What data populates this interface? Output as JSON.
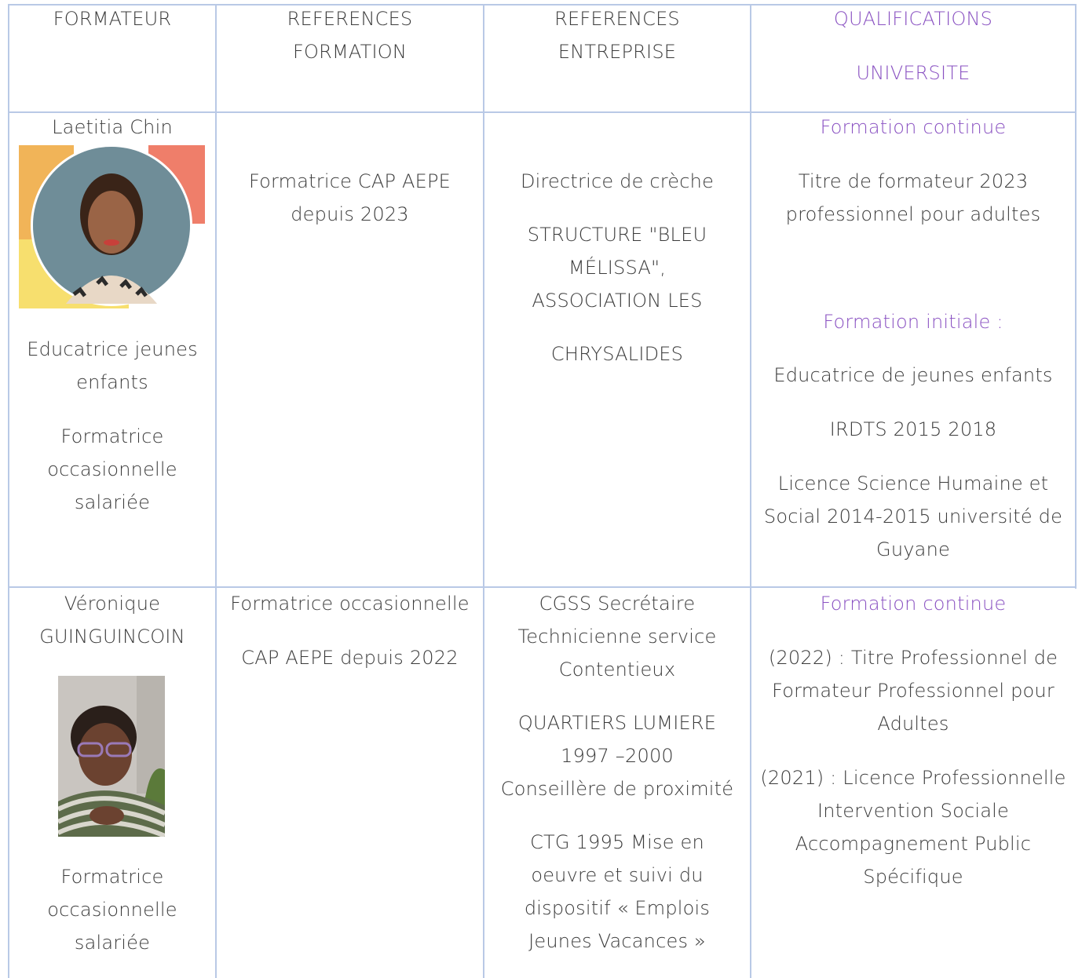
{
  "header": {
    "formateur": "FORMATEUR",
    "ref_formation": [
      "REFERENCES",
      "FORMATION"
    ],
    "ref_entreprise": [
      "REFERENCES",
      "ENTREPRISE"
    ],
    "qualifications": "QUALIFICATIONS",
    "universite": "UNIVERSITE"
  },
  "row1": {
    "name": "Laetitia Chin",
    "role1": [
      "Educatrice jeunes",
      "enfants"
    ],
    "role2": [
      "Formatrice",
      "occasionnelle",
      "salariée"
    ],
    "formation": [
      "Formatrice CAP AEPE",
      "depuis 2023"
    ],
    "entreprise": {
      "p1": "Directrice de crèche",
      "p2": [
        "STRUCTURE \"BLEU",
        "MÉLISSA\",",
        "ASSOCIATION LES"
      ],
      "p3": "CHRYSALIDES"
    },
    "qualif": {
      "continue_title": "Formation continue",
      "continue_text": [
        "Titre de formateur 2023",
        "professionnel pour adultes"
      ],
      "initiale_title": "Formation initiale :",
      "p1": "Educatrice de jeunes enfants",
      "p2": "IRDTS 2015 2018",
      "p3": [
        "Licence Science Humaine et",
        "Social 2014-2015 université de",
        "Guyane"
      ]
    }
  },
  "row2": {
    "name": [
      "Véronique",
      "GUINGUINCOIN"
    ],
    "role": [
      "Formatrice",
      "occasionnelle",
      "salariée"
    ],
    "formation": {
      "p1": "Formatrice occasionnelle",
      "p2": "CAP AEPE depuis 2022"
    },
    "entreprise": {
      "p1": [
        "CGSS Secrétaire",
        "Technicienne service",
        "Contentieux"
      ],
      "p2": [
        "QUARTIERS LUMIERE",
        "1997 –2000",
        "Conseillère de proximité"
      ],
      "p3": [
        "CTG 1995 Mise en",
        "oeuvre et suivi du",
        "dispositif « Emplois",
        "Jeunes Vacances »"
      ]
    },
    "qualif": {
      "continue_title": "Formation continue",
      "p1": [
        "(2022) : Titre Professionnel de",
        "Formateur Professionnel pour",
        "Adultes"
      ],
      "p2": [
        "(2021) : Licence Professionnelle",
        "Intervention Sociale",
        "Accompagnement Public",
        "Spécifique"
      ]
    }
  }
}
